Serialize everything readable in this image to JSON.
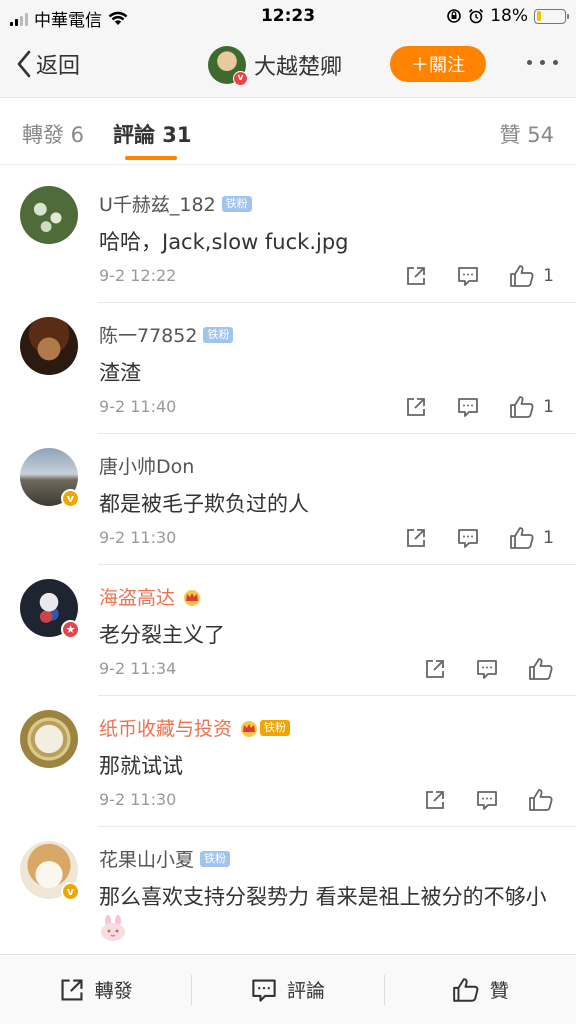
{
  "status_bar": {
    "carrier": "中華電信",
    "time": "12:23",
    "battery": "18%",
    "battery_level": 0.18
  },
  "nav": {
    "back_label": "返回",
    "user_name": "大越楚卿",
    "follow_label": "＋關注"
  },
  "tabs": {
    "repost": "轉發 6",
    "comment": "評論 31",
    "like": "贊 54"
  },
  "colors": {
    "accent": "#ff8200",
    "vip_name": "#eb7350",
    "verified_yellow": "#f0a500",
    "verified_red": "#e8424a",
    "fan_badge": "#a0c4ef"
  },
  "comments": [
    {
      "name": "U千赫兹_182",
      "badge": "铁粉",
      "text": "哈哈，Jack,slow fuck.jpg",
      "time": "9-2 12:22",
      "likes": "1",
      "avatar": "plant-photo"
    },
    {
      "name": "陈一77852",
      "badge": "铁粉",
      "text": "渣渣",
      "time": "9-2 11:40",
      "likes": "1",
      "avatar": "pirate-photo"
    },
    {
      "name": "唐小帅Don",
      "badge": "",
      "text": "都是被毛子欺负过的人",
      "time": "9-2 11:30",
      "likes": "1",
      "avatar": "seaside-photo"
    },
    {
      "name": "海盗高达",
      "badge": "",
      "text": "老分裂主义了",
      "time": "9-2 11:34",
      "likes": "",
      "avatar": "gundam-photo"
    },
    {
      "name": "纸币收藏与投资",
      "badge": "铁粉",
      "text": "那就试试",
      "time": "9-2 11:30",
      "likes": "",
      "avatar": "coin-photo"
    },
    {
      "name": "花果山小夏",
      "badge": "铁粉",
      "text": "那么喜欢支持分裂势力 看来是祖上被分的不够小",
      "time": "",
      "likes": "",
      "avatar": "dog-photo"
    }
  ],
  "bottom_bar": {
    "repost": "轉發",
    "comment": "評論",
    "like": "贊"
  }
}
